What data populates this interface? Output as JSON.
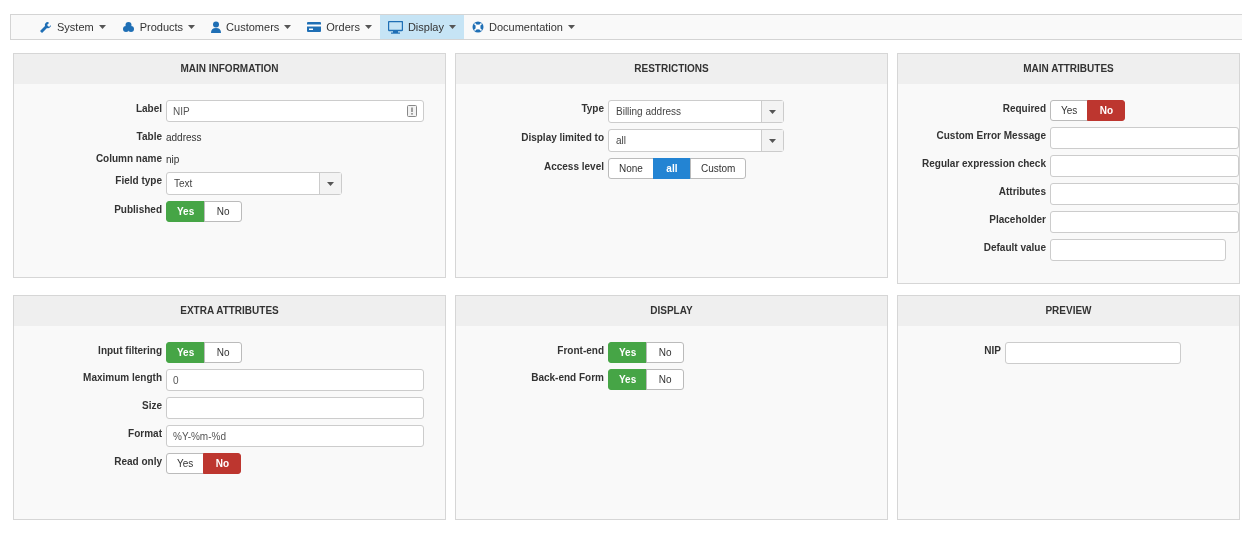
{
  "navbar": {
    "items": [
      {
        "label": "System",
        "selected": false
      },
      {
        "label": "Products",
        "selected": false
      },
      {
        "label": "Customers",
        "selected": false
      },
      {
        "label": "Orders",
        "selected": false
      },
      {
        "label": "Display",
        "selected": true
      },
      {
        "label": "Documentation",
        "selected": false
      }
    ]
  },
  "panels": [
    {
      "title": "MAIN INFORMATION",
      "kind": "form",
      "rows": [
        {
          "label": "Label",
          "kind": "text-with-icon",
          "value": "NIP"
        },
        {
          "label": "Table",
          "kind": "static",
          "value": "address"
        },
        {
          "label": "Column name",
          "kind": "static",
          "value": "nip"
        },
        {
          "label": "Field type",
          "kind": "select",
          "value": "Text"
        },
        {
          "label": "Published",
          "kind": "toggle",
          "options": [
            {
              "label": "Yes",
              "selected": true,
              "color": "#46a546"
            },
            {
              "label": "No",
              "selected": false
            }
          ]
        }
      ]
    },
    {
      "title": "RESTRICTIONS",
      "kind": "form",
      "rows": [
        {
          "label": "Type",
          "kind": "select",
          "value": "Billing address"
        },
        {
          "label": "Display limited to",
          "kind": "select",
          "value": "all"
        },
        {
          "label": "Access level",
          "kind": "toggle",
          "options": [
            {
              "label": "None",
              "selected": false
            },
            {
              "label": "all",
              "selected": true,
              "color": "#2384d3"
            },
            {
              "label": "Custom",
              "selected": false
            }
          ]
        }
      ]
    },
    {
      "title": "MAIN ATTRIBUTES",
      "kind": "form",
      "rows": [
        {
          "label": "Required",
          "kind": "toggle",
          "options": [
            {
              "label": "Yes",
              "selected": false
            },
            {
              "label": "No",
              "selected": true,
              "color": "#bd362f"
            }
          ]
        },
        {
          "label": "Custom Error Message",
          "kind": "text"
        },
        {
          "label": "Regular expression check",
          "kind": "text"
        },
        {
          "label": "Attributes",
          "kind": "text"
        },
        {
          "label": "Placeholder",
          "kind": "text"
        },
        {
          "label": "Default value",
          "kind": "short-text"
        }
      ]
    },
    {
      "title": "EXTRA ATTRIBUTES",
      "kind": "form",
      "rows": [
        {
          "label": "Input filtering",
          "kind": "toggle",
          "options": [
            {
              "label": "Yes",
              "selected": true,
              "color": "#46a546"
            },
            {
              "label": "No",
              "selected": false
            }
          ]
        },
        {
          "label": "Maximum length",
          "kind": "text",
          "value": "0"
        },
        {
          "label": "Size",
          "kind": "text"
        },
        {
          "label": "Format",
          "kind": "text",
          "value": "%Y-%m-%d"
        },
        {
          "label": "Read only",
          "kind": "toggle",
          "options": [
            {
              "label": "Yes",
              "selected": false
            },
            {
              "label": "No",
              "selected": true,
              "color": "#bd362f"
            }
          ]
        }
      ]
    },
    {
      "title": "DISPLAY",
      "kind": "form",
      "rows": [
        {
          "label": "Front-end",
          "kind": "toggle",
          "options": [
            {
              "label": "Yes",
              "selected": true,
              "color": "#46a546"
            },
            {
              "label": "No",
              "selected": false
            }
          ]
        },
        {
          "label": "Back-end Form",
          "kind": "toggle",
          "options": [
            {
              "label": "Yes",
              "selected": true,
              "color": "#46a546"
            },
            {
              "label": "No",
              "selected": false
            }
          ]
        }
      ]
    },
    {
      "title": "PREVIEW",
      "kind": "preview",
      "rows": [
        {
          "label": "NIP",
          "kind": "short-text"
        }
      ]
    }
  ]
}
